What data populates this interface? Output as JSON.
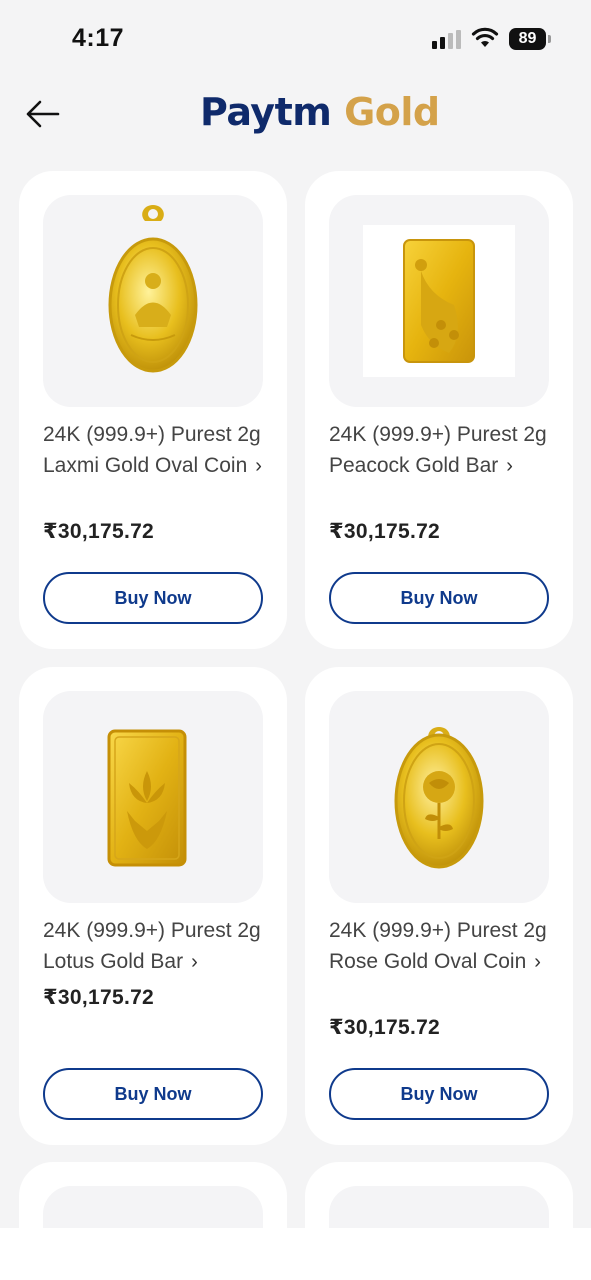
{
  "status_bar": {
    "time": "4:17",
    "battery": "89"
  },
  "header": {
    "brand_paytm": "Paytm",
    "brand_gold": "Gold"
  },
  "products": [
    {
      "title": "24K (999.9+) Purest 2g Laxmi Gold Oval Coin",
      "price": "₹30,175.72",
      "button": "Buy Now",
      "image_icon": "laxmi-oval-coin-icon"
    },
    {
      "title": "24K (999.9+) Purest 2g Peacock Gold Bar",
      "price": "₹30,175.72",
      "button": "Buy Now",
      "image_icon": "peacock-gold-bar-icon"
    },
    {
      "title": "24K (999.9+) Purest 2g Lotus Gold Bar",
      "price": "₹30,175.72",
      "button": "Buy Now",
      "image_icon": "lotus-gold-bar-icon"
    },
    {
      "title": "24K (999.9+) Purest 2g Rose Gold Oval Coin",
      "price": "₹30,175.72",
      "button": "Buy Now",
      "image_icon": "rose-oval-coin-icon"
    }
  ],
  "colors": {
    "accent": "#0f3a8c",
    "brand_blue": "#0f2a6b",
    "brand_gold": "#d4a24a",
    "background": "#f4f4f5"
  }
}
